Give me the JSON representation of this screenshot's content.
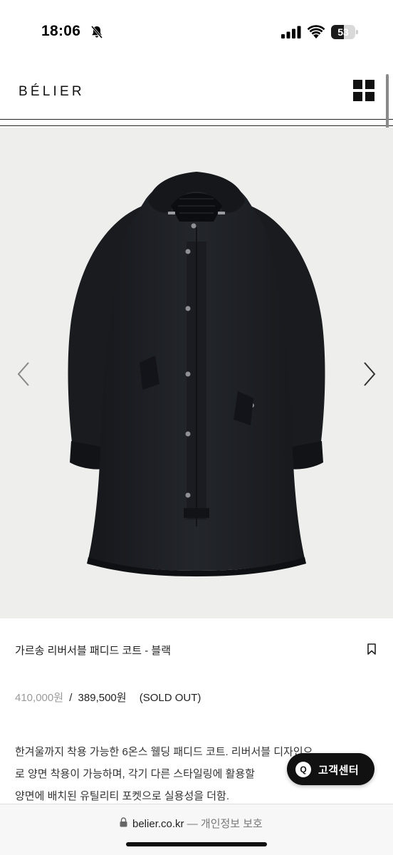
{
  "status_bar": {
    "time": "18:06",
    "battery_level": "53",
    "battery_fraction": 0.53
  },
  "header": {
    "logo": "BÉLIER",
    "menu_icon": "grid-menu-icon"
  },
  "gallery": {
    "background": "#eeeeec",
    "prev_icon": "chevron-left-icon",
    "next_icon": "chevron-right-icon"
  },
  "product": {
    "title": "가르송 리버서블 패디드 코트 - 블랙",
    "bookmark_icon": "bookmark-icon",
    "price_original": "410,000원",
    "price_separator": "/",
    "price_sale": "389,500원",
    "status": "(SOLD OUT)",
    "description": [
      "한겨울까지 착용 가능한 6온스 웰딩 패디드 코트. 리버서블 디자인으",
      "로 양면 착용이 가능하며, 각기 다른 스타일링에 활용할",
      "양면에 배치된 유틸리티 포켓으로 실용성을 더함."
    ]
  },
  "customer_service": {
    "icon_letter": "Q",
    "label": "고객센터"
  },
  "browser": {
    "domain": "belier.co.kr",
    "dash": "—",
    "privacy": "개인정보 보호"
  },
  "colors": {
    "accent": "#111111",
    "muted_price": "#9a9a9a",
    "coat": "#1c1e22"
  }
}
